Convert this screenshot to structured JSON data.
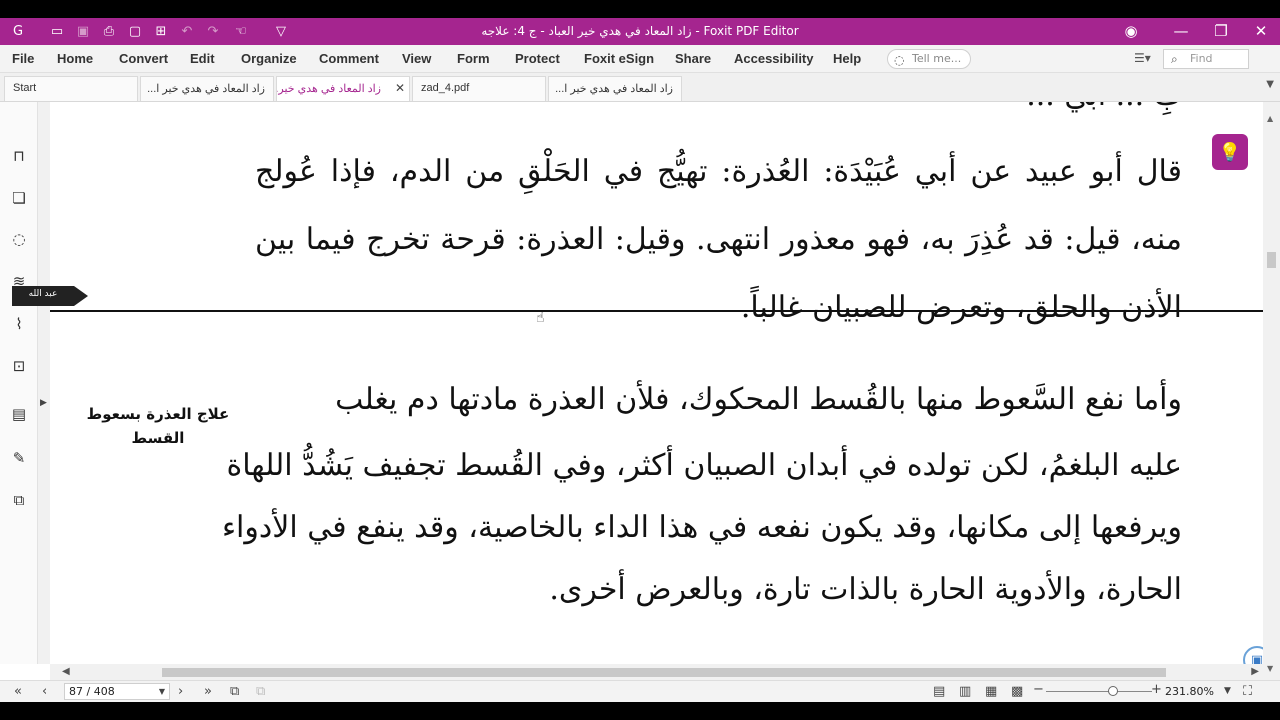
{
  "app": {
    "title": "زاد المعاد في هدي خير العباد - ج 4: علاجه - Foxit PDF Editor"
  },
  "menu": [
    "File",
    "Home",
    "Convert",
    "Edit",
    "Organize",
    "Comment",
    "View",
    "Form",
    "Protect",
    "Foxit eSign",
    "Share",
    "Accessibility",
    "Help"
  ],
  "search": {
    "tell_me_placeholder": "Tell me...",
    "find_placeholder": "Find"
  },
  "tabs": [
    {
      "label": "Start",
      "active": false
    },
    {
      "label": "زاد المعاد في هدي خير ا...",
      "active": false
    },
    {
      "label": "زاد المعاد في هدي خير...",
      "active": true
    },
    {
      "label": "zad_4.pdf",
      "active": false
    },
    {
      "label": "زاد المعاد في هدي خير ا...",
      "active": false
    }
  ],
  "bookmark_label": "عبد الله",
  "document": {
    "top_line_partial": "بِ ... أبي ...",
    "paragraph1": [
      "قال أبو عبيد عن أبي عُبَيْدَة: العُذرة: تهيُّج في الحَلْقِ من الدم، فإذا عُولج",
      "منه، قيل: قد عُذِرَ به، فهو معذور انتهى. وقيل: العذرة: قرحة تخرج فيما بين",
      "الأذن والحلق، وتعرض للصبيان غالباً."
    ],
    "side_note": "علاج العذرة بسعوط القسط",
    "paragraph2": [
      "وأما نفع السَّعوط منها بالقُسط المحكوك، فلأن العذرة مادتها دم يغلب",
      "عليه البلغمُ، لكن تولده في أبدان الصبيان أكثر، وفي القُسط تجفيف يَشُدُّ اللهاة",
      "ويرفعها إلى مكانها، وقد يكون نفعه في هذا الداء بالخاصية، وقد ينفع في الأدواء",
      "الحارة، والأدوية الحارة بالذات تارة، وبالعرض أخرى."
    ]
  },
  "status": {
    "page": "87 / 408",
    "zoom": "231.80%"
  },
  "colors": {
    "brand": "#a5258f"
  }
}
